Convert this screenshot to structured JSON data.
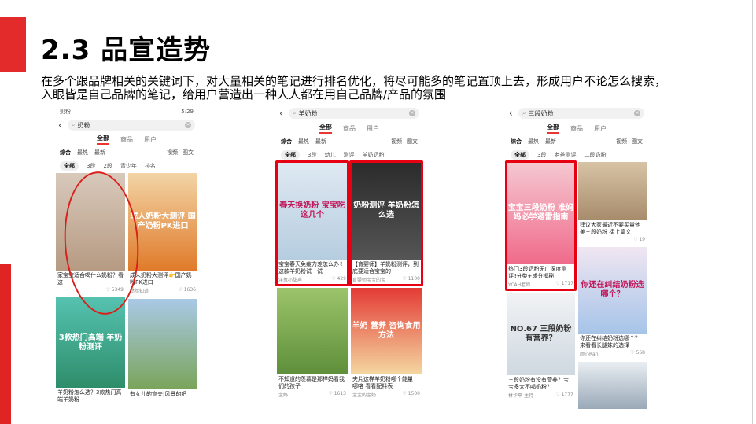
{
  "slide": {
    "title": "2.3 品宣造势",
    "description": "在多个跟品牌相关的关键词下，对大量相关的笔记进行排名优化，将尽可能多的笔记置顶上去，形成用户不论怎么搜索，入眼皆是自己品牌的笔记，给用户营造出一种人人都在用自己品牌/产品的氛围"
  },
  "colors": {
    "accent": "#e32b2b",
    "highlight": "#e60012"
  },
  "phone1": {
    "status_left": "奶粉",
    "status_right": "5:29",
    "query": "奶粉",
    "tabs": [
      "全部",
      "商品",
      "用户"
    ],
    "filters": [
      "综合",
      "最热",
      "最新"
    ],
    "filters_right": [
      "视频",
      "图文"
    ],
    "subtags": [
      "全部",
      "3段",
      "2段",
      "青少年",
      "排名"
    ],
    "cards": [
      {
        "img": "",
        "title": "家宝宝适合喝什么奶粉？看这",
        "author": "",
        "likes": "5349"
      },
      {
        "img": "成人奶粉大测评 国产奶粉PK进口",
        "title": "成人奶粉大测评👉国产奶粉PK进口",
        "author": "然然知道",
        "likes": "1636"
      },
      {
        "img": "3款热门高端 羊奶粉测评",
        "title": "羊奶粉怎么选？3款热门高端羊奶粉",
        "author": "",
        "likes": ""
      },
      {
        "img": "",
        "title": "有女儿的宣夫|风景的吧",
        "author": "",
        "likes": ""
      }
    ]
  },
  "phone2": {
    "query": "羊奶粉",
    "tabs": [
      "全部",
      "商品",
      "用户"
    ],
    "filters": [
      "综合",
      "最热",
      "最新"
    ],
    "filters_right": [
      "视频",
      "图文"
    ],
    "subtags": [
      "全部",
      "3段",
      "幼儿",
      "测评",
      "羊奶奶粉"
    ],
    "cards": [
      {
        "img": "春天换奶粉 宝宝吃这几个",
        "title": "宝宝春天免疫力差怎么办✌这款羊奶粉试一试",
        "author": "洋葱小甜声",
        "likes": "429"
      },
      {
        "img": "奶粉测评 羊奶粉怎么选",
        "title": "【育婴师】羊奶粉测评，到底要适合宝宝的",
        "author": "育婴师宝宝的宝",
        "likes": "1100"
      },
      {
        "img": "",
        "title": "不知道的羡慕是那样妈看我们的孩子",
        "author": "宝妈",
        "likes": "1613"
      },
      {
        "img": "羊奶 营养 咨询食用方法",
        "title": "夹片这样羊奶粉哪个能量 哪咯 看看配料表",
        "author": "宝宝的宝奶",
        "likes": "1500"
      }
    ]
  },
  "phone3": {
    "query": "三段奶粉",
    "tabs": [
      "全部",
      "商品",
      "用户"
    ],
    "filters": [
      "综合",
      "最热",
      "最新"
    ],
    "filters_right": [
      "视频",
      "图文"
    ],
    "subtags": [
      "全部",
      "3段",
      "老爸测评",
      "二段奶粉"
    ],
    "cards": [
      {
        "img": "宝宝三段奶粉 准妈妈必学避雷指南",
        "title": "热门3段奶粉无广深度测评‼分类+成分揭秘",
        "author": "YCAH老师",
        "likes": "1717"
      },
      {
        "img": "",
        "title": "建议大家最近不要买量他美三段奶粉 捷上篇文",
        "author": "",
        "likes": "19"
      },
      {
        "img": "你还在纠结奶粉选哪个？",
        "title": "你还在纠结奶粉选哪个？来看看长腿妹的选择",
        "author": "颜心Ran",
        "likes": "568"
      },
      {
        "img": "NO.67 三段奶粉有营养？",
        "title": "三段奶粉有没有营养？宝宝多大不喝奶粉？",
        "author": "林华平-主持",
        "likes": "1777"
      }
    ]
  }
}
